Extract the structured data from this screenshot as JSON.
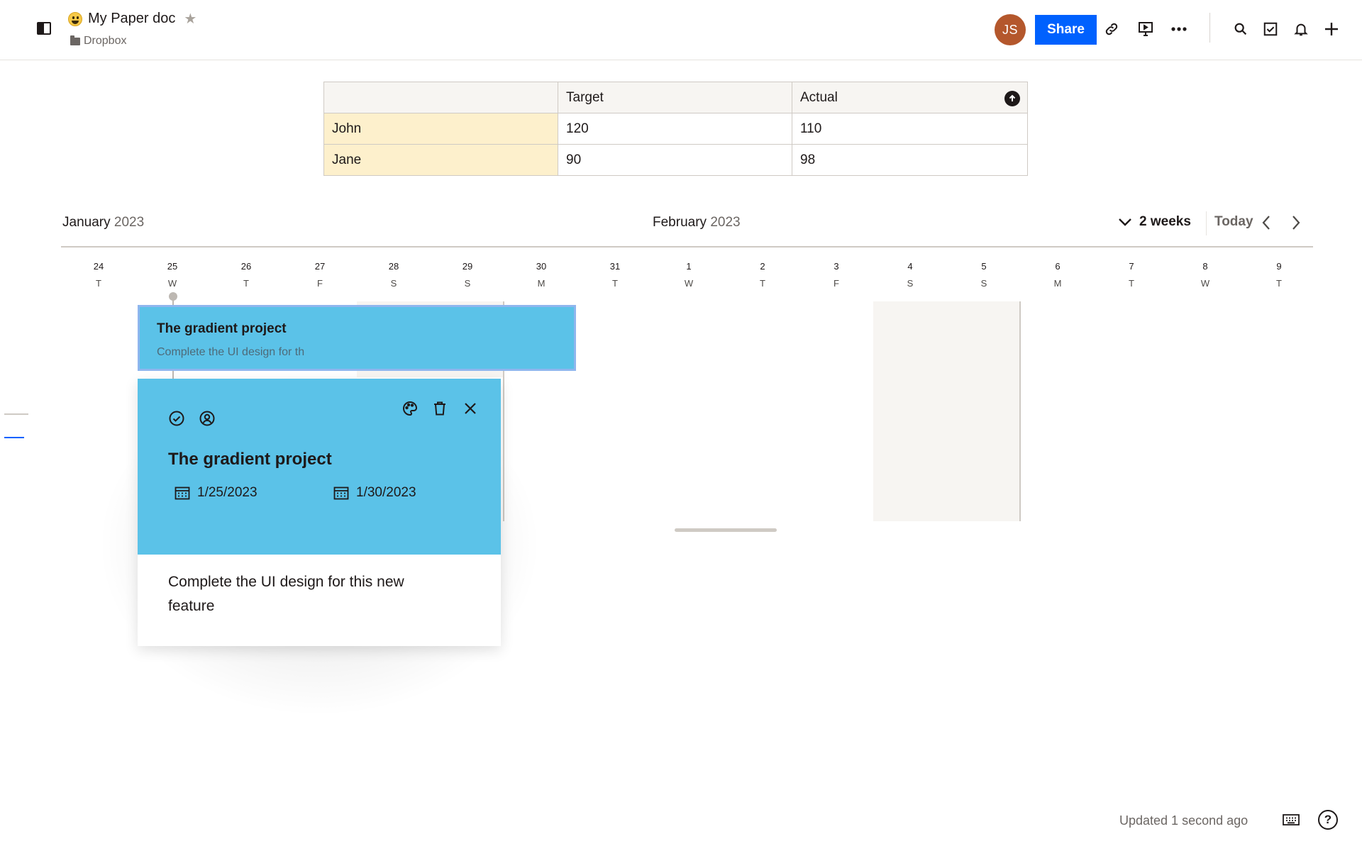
{
  "header": {
    "doc_title": "My Paper doc",
    "location": "Dropbox",
    "avatar_initials": "JS",
    "share_label": "Share"
  },
  "table": {
    "headers": [
      "",
      "Target",
      "Actual"
    ],
    "rows": [
      [
        "John",
        "120",
        "110"
      ],
      [
        "Jane",
        "90",
        "98"
      ]
    ]
  },
  "timeline": {
    "months": [
      {
        "name": "January",
        "year": "2023"
      },
      {
        "name": "February",
        "year": "2023"
      }
    ],
    "range_label": "2 weeks",
    "today_label": "Today",
    "days": [
      {
        "num": "24",
        "dow": "T"
      },
      {
        "num": "25",
        "dow": "W"
      },
      {
        "num": "26",
        "dow": "T"
      },
      {
        "num": "27",
        "dow": "F"
      },
      {
        "num": "28",
        "dow": "S"
      },
      {
        "num": "29",
        "dow": "S"
      },
      {
        "num": "30",
        "dow": "M"
      },
      {
        "num": "31",
        "dow": "T"
      },
      {
        "num": "1",
        "dow": "W"
      },
      {
        "num": "2",
        "dow": "T"
      },
      {
        "num": "3",
        "dow": "F"
      },
      {
        "num": "4",
        "dow": "S"
      },
      {
        "num": "5",
        "dow": "S"
      },
      {
        "num": "6",
        "dow": "M"
      },
      {
        "num": "7",
        "dow": "T"
      },
      {
        "num": "8",
        "dow": "W"
      },
      {
        "num": "9",
        "dow": "T"
      }
    ],
    "task": {
      "title": "The gradient project",
      "subtitle": "Complete the UI design for th",
      "color": "#5bc2e8"
    }
  },
  "card": {
    "title": "The gradient project",
    "start_date": "1/25/2023",
    "end_date": "1/30/2023",
    "description": "Complete the UI design for this new feature"
  },
  "footer": {
    "status": "Updated 1 second ago",
    "help_label": "?"
  },
  "colors": {
    "accent": "#0061fe",
    "task": "#5bc2e8",
    "avatar": "#b4572c",
    "row_highlight": "#fdf0cc"
  }
}
